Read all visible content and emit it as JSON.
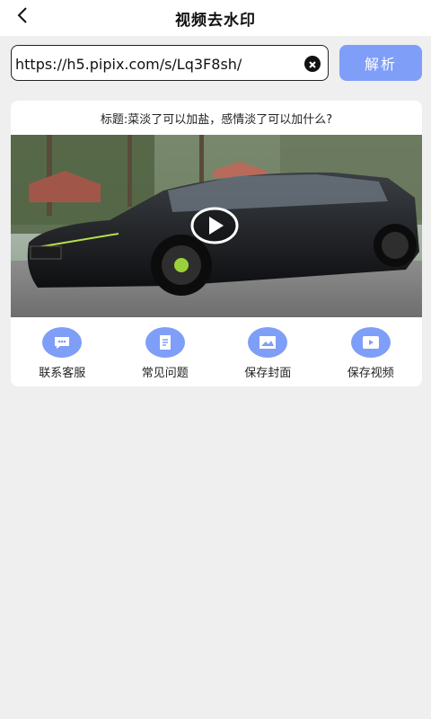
{
  "header": {
    "title": "视频去水印",
    "back_icon": "chevron-left-icon"
  },
  "url_bar": {
    "value": "https://h5.pipix.com/s/Lq3F8sh/",
    "clear_icon": "close-circle-icon",
    "parse_label": "解析"
  },
  "video_card": {
    "title": "标题:菜淡了可以加盐，感情淡了可以加什么?",
    "play_icon": "play-icon"
  },
  "actions": [
    {
      "label": "联系客服",
      "icon": "chat-bubble-icon"
    },
    {
      "label": "常见问题",
      "icon": "document-icon"
    },
    {
      "label": "保存封面",
      "icon": "image-icon"
    },
    {
      "label": "保存视频",
      "icon": "video-play-icon"
    }
  ],
  "colors": {
    "accent": "#7e9ef8",
    "background": "#efefef",
    "card": "#ffffff"
  }
}
